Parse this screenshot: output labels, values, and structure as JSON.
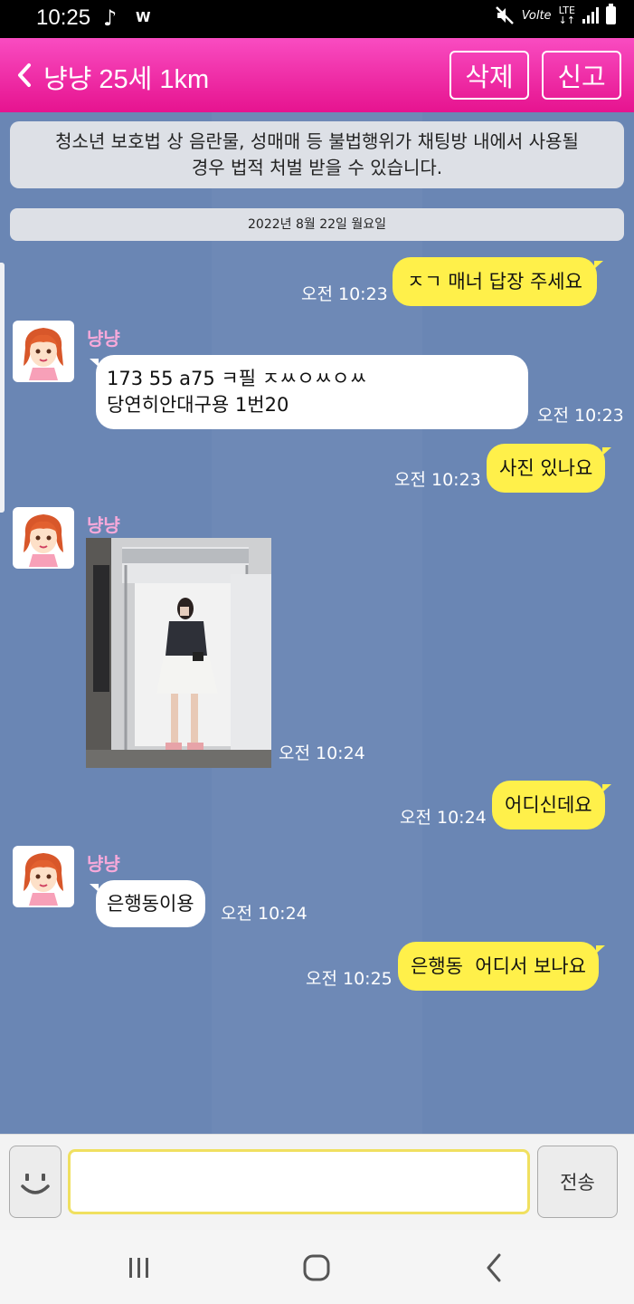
{
  "status_bar": {
    "time": "10:25",
    "tiktok_glyph": "♪",
    "app_badge": "W",
    "volte": "Volte",
    "lte": "LTE"
  },
  "header": {
    "title": "냥냥 25세 1km",
    "delete_label": "삭제",
    "report_label": "신고",
    "gradient_top": "#f94cc1",
    "gradient_bottom": "#e6138f"
  },
  "chat": {
    "notice": [
      "청소년 보호법 상 음란물, 성매매 등 불법행위가 채팅방 내에서 사용될",
      "경우 법적 처벌 받을 수 있습니다."
    ],
    "date": "2022년 8월 22일 월요일",
    "messages": [
      {
        "from": "me",
        "text": "ㅈㄱ 매너 답장 주세요",
        "time": "오전 10:23"
      },
      {
        "from": "them",
        "sender": "냥냥",
        "lines": [
          "173 55 a75 ㅋ필 ㅈㅆㅇㅆㅇㅆ",
          "당연히안대구용 1번20"
        ],
        "time": "오전 10:23"
      },
      {
        "from": "me",
        "text": "사진 있나요",
        "time": "오전 10:23"
      },
      {
        "from": "them",
        "sender": "냥냥",
        "type": "photo",
        "time": "오전 10:24"
      },
      {
        "from": "me",
        "text": "어디신데요",
        "time": "오전 10:24"
      },
      {
        "from": "them",
        "sender": "냥냥",
        "text": "은행동이용",
        "time": "오전 10:24"
      },
      {
        "from": "me",
        "text": "은행동  어디서 보나요",
        "time": "오전 10:25"
      }
    ],
    "bubble_me_color": "#fff04a",
    "background_color": "#6a86b4"
  },
  "input": {
    "placeholder": "",
    "value": "",
    "send_label": "전송"
  }
}
